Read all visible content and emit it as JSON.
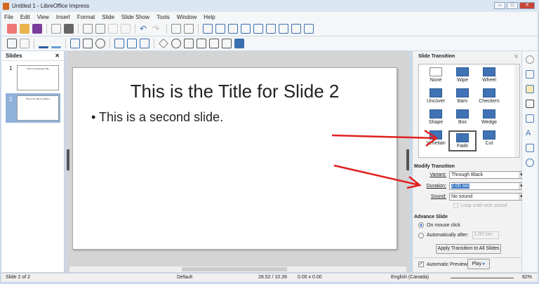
{
  "window": {
    "title": "Untitled 1 - LibreOffice Impress"
  },
  "menu": [
    "File",
    "Edit",
    "View",
    "Insert",
    "Format",
    "Slide",
    "Slide Show",
    "Tools",
    "Window",
    "Help"
  ],
  "slides_pane": {
    "title": "Slides",
    "thumbs": [
      {
        "num": "1",
        "title": "This is an Example Title"
      },
      {
        "num": "2",
        "title": "This is the Title for Slide 2"
      }
    ]
  },
  "slide": {
    "title": "This is the Title for Slide 2",
    "bullet": "This is a second slide."
  },
  "sidebar": {
    "title": "Slide Transition",
    "transitions": [
      "None",
      "Wipe",
      "Wheel",
      "Uncover",
      "Bars",
      "Checkers",
      "Shape",
      "Box",
      "Wedge",
      "Venetian",
      "Fade",
      "Cut"
    ],
    "selected": "Fade",
    "modify_title": "Modify Transition",
    "variant_label": "Variant:",
    "variant": "Through Black",
    "duration_label": "Duration:",
    "duration": "2.00 sec",
    "sound_label": "Sound:",
    "sound": "No sound",
    "loop_label": "Loop until next sound",
    "advance_title": "Advance Slide",
    "on_click": "On mouse click",
    "auto_after": "Automatically after:",
    "auto_value": "1.00 sec",
    "apply_all": "Apply Transition to All Slides",
    "auto_preview": "Automatic Preview",
    "play": "Play"
  },
  "status": {
    "slide": "Slide 2 of 2",
    "layout": "Default",
    "position": "28.52 / 10.39",
    "size": "0.00 x 0.00",
    "language": "English (Canada)",
    "zoom": "82%"
  }
}
